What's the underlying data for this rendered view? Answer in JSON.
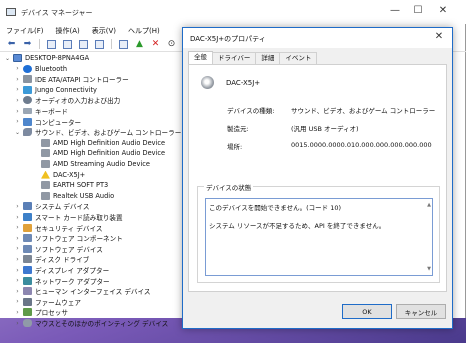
{
  "device_manager": {
    "title": "デバイス マネージャー",
    "menu": [
      "ファイル(F)",
      "操作(A)",
      "表示(V)",
      "ヘルプ(H)"
    ],
    "tree": [
      {
        "label": "DESKTOP-8PNA4GA",
        "chevron": "⌄",
        "icon": "pc",
        "level": 0
      },
      {
        "label": "Bluetooth",
        "chevron": "›",
        "icon": "bt",
        "level": 1
      },
      {
        "label": "IDE ATA/ATAPI コントローラー",
        "chevron": "›",
        "icon": "drive",
        "level": 1
      },
      {
        "label": "Jungo Connectivity",
        "chevron": "›",
        "icon": "jungo",
        "level": 1
      },
      {
        "label": "オーディオの入力および出力",
        "chevron": "›",
        "icon": "audio",
        "level": 1
      },
      {
        "label": "キーボード",
        "chevron": "›",
        "icon": "kbd",
        "level": 1
      },
      {
        "label": "コンピューター",
        "chevron": "›",
        "icon": "comp",
        "level": 1
      },
      {
        "label": "サウンド、ビデオ、およびゲーム コントローラー",
        "chevron": "⌄",
        "icon": "snd",
        "level": 1
      },
      {
        "label": "AMD High Definition Audio Device",
        "chevron": "",
        "icon": "dev",
        "level": 2
      },
      {
        "label": "AMD High Definition Audio Device",
        "chevron": "",
        "icon": "dev",
        "level": 2
      },
      {
        "label": "AMD Streaming Audio Device",
        "chevron": "",
        "icon": "dev",
        "level": 2
      },
      {
        "label": "DAC-X5J+",
        "chevron": "",
        "icon": "warn",
        "level": 2
      },
      {
        "label": "EARTH SOFT PT3",
        "chevron": "",
        "icon": "dev",
        "level": 2
      },
      {
        "label": "Realtek USB Audio",
        "chevron": "",
        "icon": "dev",
        "level": 2
      },
      {
        "label": "システム デバイス",
        "chevron": "›",
        "icon": "sys",
        "level": 1
      },
      {
        "label": "スマート カード読み取り装置",
        "chevron": "›",
        "icon": "card",
        "level": 1
      },
      {
        "label": "セキュリティ デバイス",
        "chevron": "›",
        "icon": "sec",
        "level": 1
      },
      {
        "label": "ソフトウェア コンポーネント",
        "chevron": "›",
        "icon": "sw",
        "level": 1
      },
      {
        "label": "ソフトウェア デバイス",
        "chevron": "›",
        "icon": "sw",
        "level": 1
      },
      {
        "label": "ディスク ドライブ",
        "chevron": "›",
        "icon": "disk",
        "level": 1
      },
      {
        "label": "ディスプレイ アダプター",
        "chevron": "›",
        "icon": "disp",
        "level": 1
      },
      {
        "label": "ネットワーク アダプター",
        "chevron": "›",
        "icon": "net",
        "level": 1
      },
      {
        "label": "ヒューマン インターフェイス デバイス",
        "chevron": "›",
        "icon": "hid",
        "level": 1
      },
      {
        "label": "ファームウェア",
        "chevron": "›",
        "icon": "fw",
        "level": 1
      },
      {
        "label": "プロセッサ",
        "chevron": "›",
        "icon": "cpu",
        "level": 1
      },
      {
        "label": "マウスとそのほかのポインティング デバイス",
        "chevron": "›",
        "icon": "mouse",
        "level": 1
      }
    ]
  },
  "dialog": {
    "title": "DAC-X5J+のプロパティ",
    "tabs": [
      "全般",
      "ドライバー",
      "詳細",
      "イベント"
    ],
    "device_name": "DAC-X5J+",
    "fields": [
      {
        "key": "デバイスの種類:",
        "value": "サウンド、ビデオ、およびゲーム コントローラー"
      },
      {
        "key": "製造元:",
        "value": "(汎用 USB オーディオ)"
      },
      {
        "key": "場所:",
        "value": "0015.0000.0000.010.000.000.000.000.000"
      }
    ],
    "status_legend": "デバイスの状態",
    "status_lines": [
      "このデバイスを開始できません。(コード 10)",
      "システム リソースが不足するため、API を終了できません。"
    ],
    "ok_label": "OK",
    "cancel_label": "キャンセル"
  }
}
